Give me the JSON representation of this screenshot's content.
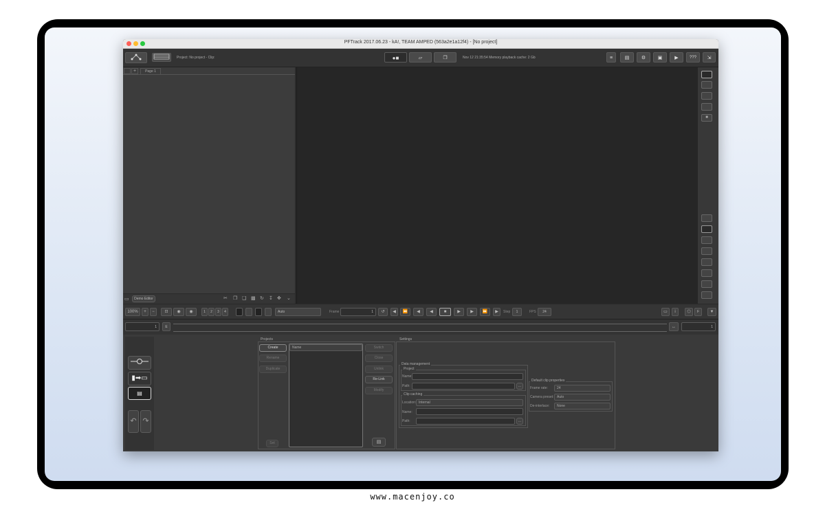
{
  "window": {
    "title": "PFTrack 2017.06.23 - kA!, TEAM AMPED (563a2e1a12f4) - [No project]"
  },
  "toolbar": {
    "project_status": "Project: No project - Clip:",
    "status_message": "Nov 12 21:35:54 Memory playback cache: 2 Gb",
    "help_label": "???"
  },
  "tree": {
    "page_tab": "Page 1",
    "demo_editor_label": "Demo Editor"
  },
  "controls": {
    "zoom_value": "100%",
    "frames_keys": [
      "1",
      "2",
      "3",
      "4"
    ],
    "display_mode": "Auto",
    "frame_label": "Frame",
    "frame_value": "1",
    "step_label": "Step",
    "step_value": "1",
    "fps_label": "FPS",
    "fps_value": "24",
    "f_key": "F"
  },
  "timeline": {
    "start_frame": "1",
    "end_frame": "1",
    "marker": "E"
  },
  "projects": {
    "section_label": "Projects",
    "create": "Create",
    "rename": "Rename",
    "duplicate": "Duplicate",
    "list_header": "Name",
    "switch": "Switch",
    "close": "Close",
    "unlink": "Unlink",
    "relink": "Re-Link",
    "modify": "Modify",
    "set": "Set"
  },
  "settings": {
    "section_label": "Settings",
    "data_management": "Data management",
    "project_group": "Project",
    "name_label": "Name:",
    "path_label": "Path:",
    "clip_caching": "Clip caching",
    "location_label": "Location:",
    "location_value": "Internal",
    "default_clip": "Default clip properties",
    "frame_rate_label": "Frame rate:",
    "frame_rate_value": "24",
    "camera_preset_label": "Camera preset:",
    "camera_preset_value": "Auto",
    "deinterlace_label": "De-interlace:",
    "deinterlace_value": "None",
    "browse": "..."
  },
  "watermark": "www.macenjoy.co",
  "colors": {
    "panel": "#3a3a3a",
    "viewer": "#262626",
    "close": "#ff5f57",
    "minimize": "#febc2e",
    "zoom": "#28c840"
  }
}
